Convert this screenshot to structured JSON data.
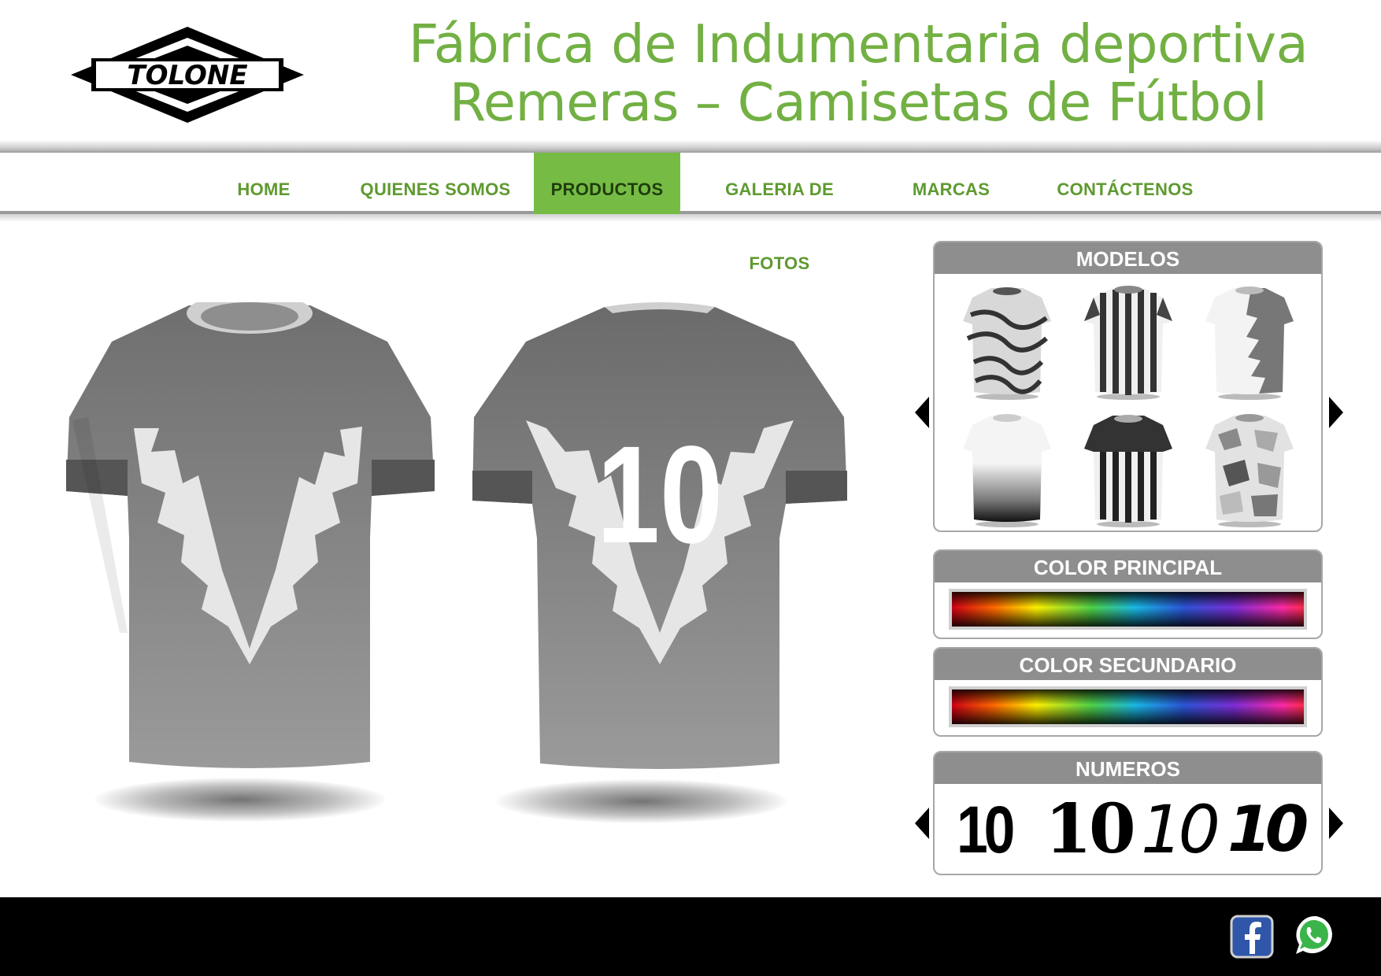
{
  "brand": {
    "logo_text": "TOLONE"
  },
  "header": {
    "title_line1": "Fábrica de Indumentaria deportiva",
    "title_line2": "Remeras – Camisetas de Fútbol"
  },
  "nav": {
    "items": [
      {
        "label": "HOME"
      },
      {
        "label": "QUIENES SOMOS"
      },
      {
        "label": "PRODUCTOS"
      },
      {
        "label": "GALERIA DE FOTOS"
      },
      {
        "label": "MARCAS"
      },
      {
        "label": "CONTÁCTENOS"
      }
    ],
    "active": "PRODUCTOS"
  },
  "preview": {
    "back_number": "10",
    "accent": "#76bc44"
  },
  "panels": {
    "modelos": {
      "title": "MODELOS"
    },
    "color_principal": {
      "title": "COLOR PRINCIPAL"
    },
    "color_secundario": {
      "title": "COLOR SECUNDARIO"
    },
    "numeros": {
      "title": "NUMEROS",
      "options": [
        "10",
        "10",
        "10",
        "10"
      ]
    }
  },
  "footer": {
    "icons": [
      "facebook-icon",
      "whatsapp-icon"
    ]
  }
}
